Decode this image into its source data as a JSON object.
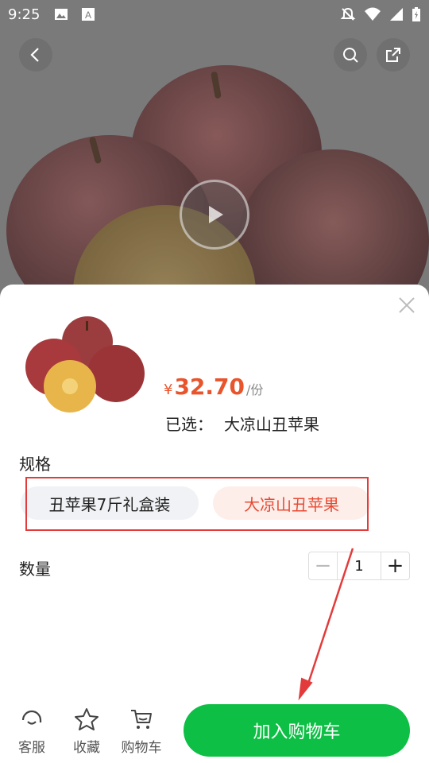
{
  "status_bar": {
    "time": "9:25",
    "icons": [
      "image-icon",
      "a-icon",
      "mute-icon",
      "wifi-icon",
      "signal-icon",
      "battery-icon"
    ]
  },
  "hero": {
    "icons": [
      "back-icon",
      "search-icon",
      "share-icon",
      "play-icon"
    ]
  },
  "product": {
    "currency": "¥",
    "price": "32.70",
    "unit": "/份",
    "selected_label": "已选：",
    "selected_value": "大凉山丑苹果"
  },
  "spec": {
    "title": "规格",
    "options": [
      {
        "label": "丑苹果7斤礼盒装",
        "selected": false
      },
      {
        "label": "大凉山丑苹果",
        "selected": true
      }
    ]
  },
  "quantity": {
    "title": "数量",
    "minus": "−",
    "value": "1",
    "plus": "+"
  },
  "bottom_bar": {
    "service_label": "客服",
    "favorite_label": "收藏",
    "cart_label": "购物车",
    "add_to_cart": "加入购物车"
  },
  "colors": {
    "price": "#e8542b",
    "selected_chip_text": "#e84b33",
    "selected_chip_bg": "#fdeeea",
    "primary_button": "#0dbf44",
    "annotation": "#e33b3b"
  }
}
